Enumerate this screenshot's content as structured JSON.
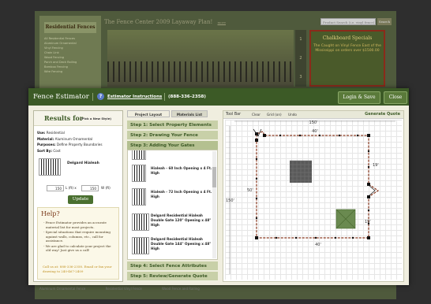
{
  "background": {
    "sidebar_title": "Residential Fences",
    "sidebar_links": [
      "All Residential Fences",
      "Aluminum Ornamental",
      "Vinyl Fencing",
      "Chain Link",
      "Wood Fencing",
      "Porch and Deck Railing",
      "Bamboo Fencing",
      "Wire Fencing"
    ],
    "header_title": "The Fence Center 2009 Layaway Plan!",
    "header_link": "more",
    "search_placeholder": "Product Search (i.e. vinyl fence)",
    "search_button": "Search",
    "slide_numbers": [
      "1",
      "2",
      "3"
    ],
    "special_title": "Chalkboard Specials",
    "special_text": "The Caught on Vinyl Fence East of the Mississippi on orders over $1500.00",
    "footer_links": [
      "Aluminum Ornamental Fence",
      "Residential Vinyl Fence",
      "Wood Fence and Railing"
    ]
  },
  "modal": {
    "title": "Fence Estimator",
    "instructions_link": "Estimator Instructions",
    "phone": "(888-336-2358)",
    "login_button": "Login & Save",
    "close_button": "Close"
  },
  "results": {
    "title": "Results for",
    "pick_style": "(Pick a New Style)",
    "use_label": "Use:",
    "use_value": "Residential",
    "material_label": "Material:",
    "material_value": "Aluminum Ornamental",
    "purposes_label": "Purposes:",
    "purposes_value": "Define Property Boundaries",
    "sort_label": "Sort By:",
    "sort_value": "Cost",
    "product_name": "Delgard Hialeah",
    "length_value": "150",
    "length_label": "L (ft) x",
    "width_value": "150",
    "width_label": "W (ft)",
    "update_button": "Update"
  },
  "help": {
    "title": "Help?",
    "items": [
      "- Fence Estimator provides an accurate material list for most projects.",
      "- Special situations that require mounting against walls, columns, etc., call for assistance.",
      "- We are glad to calculate your project the old way! Just give us a call!"
    ],
    "call_text": "Call us at: 888-336-2358. Email or fax your drawing to 240-467-2409"
  },
  "layout_tabs": {
    "project_layout": "Project Layout",
    "materials_list": "Materials List"
  },
  "steps": {
    "s1": "Step 1: Select Property Elements",
    "s2": "Step 2: Drawing Your Fence",
    "s3": "Step 3: Adding Your Gates",
    "s4": "Step 4: Select Fence Attributes",
    "s5": "Step 5: Review/Generate Quote"
  },
  "gates": [
    {
      "name": "Hialeah - 60 Inch Opening x 4 Ft. High"
    },
    {
      "name": "Hialeah - 72 Inch Opening x 4 Ft. High"
    },
    {
      "name": "Delgard Residential Hialeah Double Gate 120\" Opening x 48\" High"
    },
    {
      "name": "Delgard Residential Hialeah Double Gate 144\" Opening x 48\" High"
    }
  ],
  "toolbar": {
    "label": "Tool Bar",
    "clear": "Clear",
    "grid": "Grid (on)",
    "undo": "Undo",
    "generate_quote": "Generate Quote"
  },
  "drawing": {
    "outer_width": "150'",
    "outer_height": "150'",
    "top": "40'",
    "left": "50'",
    "right": "19'",
    "right_low": "19'",
    "bottom": "40'"
  },
  "colors": {
    "header_green": "#3c5a26",
    "step_green": "#c8d0a8",
    "fence_brown": "#8a3a20",
    "building_gray": "#5a5a5a",
    "tree_green": "#6a8a50"
  }
}
